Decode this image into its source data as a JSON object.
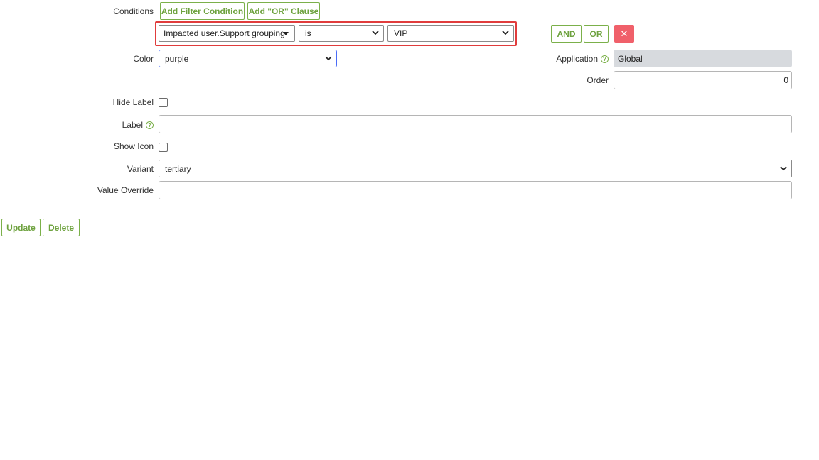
{
  "conditions": {
    "label": "Conditions",
    "add_filter_label": "Add Filter Condition",
    "add_or_label": "Add \"OR\" Clause",
    "field_value": "Impacted user.Support grouping",
    "operator_value": "is",
    "value_value": "VIP",
    "and_label": "AND",
    "or_label": "OR",
    "remove_label": "✕",
    "highlight_color": "#e03c3c"
  },
  "color_field": {
    "label": "Color",
    "value": "purple",
    "focus_color": "#4a6cf7"
  },
  "application": {
    "label": "Application",
    "value": "Global"
  },
  "order": {
    "label": "Order",
    "value": "0"
  },
  "hide_label": {
    "label": "Hide Label"
  },
  "label_field": {
    "label": "Label",
    "value": ""
  },
  "show_icon": {
    "label": "Show Icon"
  },
  "variant": {
    "label": "Variant",
    "value": "tertiary"
  },
  "value_override": {
    "label": "Value Override",
    "value": ""
  },
  "actions": {
    "update_label": "Update",
    "delete_label": "Delete"
  },
  "colors": {
    "accent": "#7bb04a",
    "danger": "#f0606a",
    "readonly_bg": "#d7dade"
  }
}
